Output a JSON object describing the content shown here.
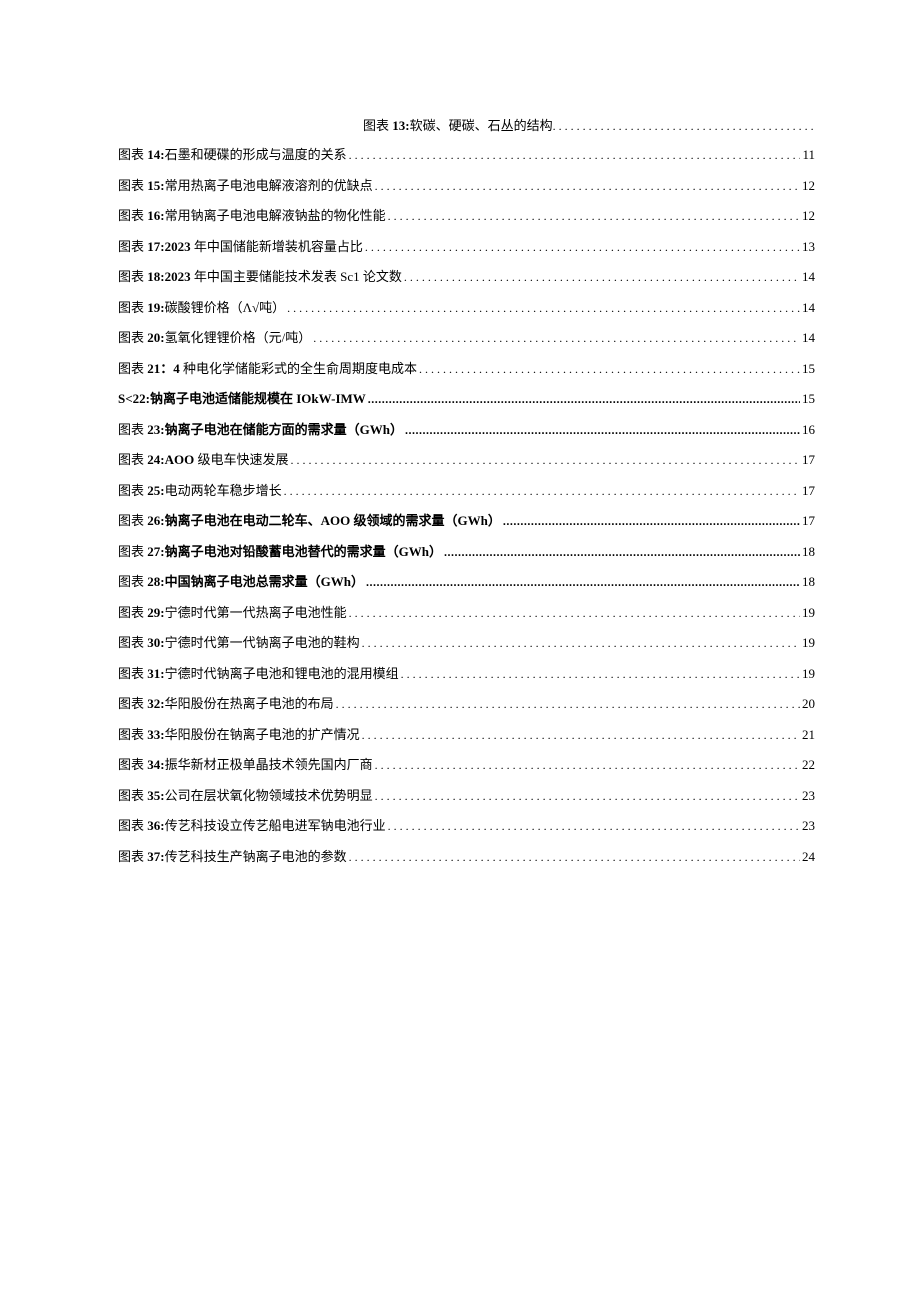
{
  "toc": {
    "first_entry": {
      "prefix": "图表 ",
      "num": "13:",
      "title": "软碳、硬碳、石丛的结构",
      "dots": ". . . . . . . . . . . . . . . . . . . . . . . . . . . . . . . . . . . . . . . . . . . . . . . . . . . . . . . . . .",
      "page": ""
    },
    "entries": [
      {
        "prefix": "图表 ",
        "num": "14:",
        "title": "石墨和硬碟的形成与温度的关系",
        "page": "11",
        "bold": false
      },
      {
        "prefix": "图表 ",
        "num": "15:",
        "title": "常用热离子电池电解液溶剂的优缺点",
        "page": "12",
        "bold": false
      },
      {
        "prefix": "图表 ",
        "num": "16:",
        "title": "常用钠离子电池电解液钠盐的物化性能",
        "page": "12",
        "bold": false
      },
      {
        "prefix": "图表 ",
        "num": "17:2023 ",
        "title": "年中国储能新增装机容量占比",
        "page": "13",
        "bold": false
      },
      {
        "prefix": "图表 ",
        "num": "18:2023 ",
        "title": "年中国主要储能技术发表 Sc1 论文数",
        "page": "14",
        "bold": false
      },
      {
        "prefix": "图表 ",
        "num": "19:",
        "title": "碳酸锂价格（Λ√吨）",
        "page": "14",
        "bold": false
      },
      {
        "prefix": "图表 ",
        "num": "20:",
        "title": "氢氧化锂锂价格（元/吨）",
        "page": "14",
        "bold": false
      },
      {
        "prefix": "图表 ",
        "num": "21：4 ",
        "title": "种电化学储能彩式的全生俞周期度电成本",
        "page": "15",
        "bold": false
      },
      {
        "prefix": "",
        "num": "S<22:",
        "title": "钠离子电池适储能规模在 IOkW-IMW ",
        "page": "15",
        "bold": true
      },
      {
        "prefix": "图表 ",
        "num": "23:",
        "title": "钠离子电池在储能方面的需求量（GWh）",
        "page": "16",
        "bold": true
      },
      {
        "prefix": "图表 ",
        "num": "24:AOO ",
        "title": "级电车快速发展",
        "page": "17",
        "bold": false
      },
      {
        "prefix": "图表 ",
        "num": "25:",
        "title": "电动两轮车稳步增长",
        "page": "17",
        "bold": false
      },
      {
        "prefix": "图表 ",
        "num": "26:",
        "title": "钠离子电池在电动二轮车、AOO 级领域的需求量（GWh）",
        "page": "17",
        "bold": true
      },
      {
        "prefix": "图表 ",
        "num": "27:",
        "title": "钠离子电池对铅酸蓄电池替代的需求量（GWh）",
        "page": "18",
        "bold": true
      },
      {
        "prefix": "图表 ",
        "num": "28:",
        "title": "中国钠离子电池总需求量（GWh）",
        "page": "18",
        "bold": true
      },
      {
        "prefix": "图表 ",
        "num": "29:",
        "title": "宁德时代第一代热离子电池性能",
        "page": "19",
        "bold": false
      },
      {
        "prefix": "图表 ",
        "num": "30:",
        "title": "宁德时代第一代钠离子电池的鞋构",
        "page": "19",
        "bold": false
      },
      {
        "prefix": "图表 ",
        "num": "31:",
        "title": "宁德时代钠离子电池和锂电池的混用模组",
        "page": "19",
        "bold": false
      },
      {
        "prefix": "图表 ",
        "num": "32:",
        "title": "华阳股份在热离子电池的布局",
        "page": "20",
        "bold": false
      },
      {
        "prefix": "图表 ",
        "num": "33:",
        "title": "华阳股份在钠离子电池的扩产情况",
        "page": "21",
        "bold": false
      },
      {
        "prefix": "图表 ",
        "num": "34:",
        "title": "振华新材正极单晶技术领先国内厂商",
        "page": "22",
        "bold": false
      },
      {
        "prefix": "图表 ",
        "num": "35:",
        "title": "公司在层状氧化物领域技术优势明显",
        "page": "23",
        "bold": false
      },
      {
        "prefix": "图表 ",
        "num": "36:",
        "title": "传艺科技设立传艺船电进军钠电池行业",
        "page": "23",
        "bold": false
      },
      {
        "prefix": "图表 ",
        "num": "37:",
        "title": "传艺科技生产钠离子电池的参数",
        "page": "24",
        "bold": false
      }
    ]
  }
}
